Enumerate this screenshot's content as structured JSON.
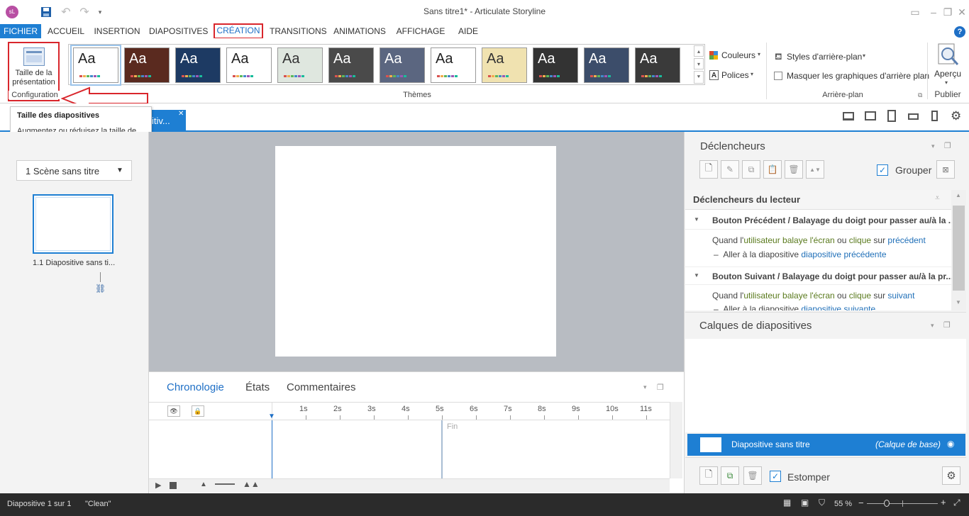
{
  "app": {
    "title": "Sans titre1* -  Articulate Storyline",
    "logo_text": "sL"
  },
  "menu": {
    "tabs": [
      "FICHIER",
      "ACCUEIL",
      "INSERTION",
      "DIAPOSITIVES",
      "CRÉATION",
      "TRANSITIONS",
      "ANIMATIONS",
      "AFFICHAGE",
      "AIDE"
    ],
    "active": "CRÉATION"
  },
  "ribbon": {
    "size_button": "Taille de la présentation",
    "group_config": "Configuration",
    "group_themes": "Thèmes",
    "colors_label": "Couleurs",
    "fonts_label": "Polices",
    "bg_styles_label": "Styles d'arrière-plan",
    "hide_bg_label": "Masquer les graphiques d'arrière plan",
    "group_bg": "Arrière-plan",
    "preview_label": "Aperçu",
    "group_publish": "Publier",
    "theme_thumb_text": "Aa",
    "themes": [
      {
        "bg": "#ffffff",
        "fg": "#222222"
      },
      {
        "bg": "#5a2a1f",
        "fg": "#ffffff"
      },
      {
        "bg": "#1d3a63",
        "fg": "#ffffff"
      },
      {
        "bg": "#ffffff",
        "fg": "#222222"
      },
      {
        "bg": "#dfe7df",
        "fg": "#333333"
      },
      {
        "bg": "#4a4a4a",
        "fg": "#ffffff"
      },
      {
        "bg": "#5b6680",
        "fg": "#ffffff"
      },
      {
        "bg": "#ffffff",
        "fg": "#222222"
      },
      {
        "bg": "#f0e2b0",
        "fg": "#333333"
      },
      {
        "bg": "#333333",
        "fg": "#ffffff"
      },
      {
        "bg": "#3c4d6a",
        "fg": "#ffffff"
      },
      {
        "bg": "#3a3a3a",
        "fg": "#ffffff"
      }
    ]
  },
  "tooltip": {
    "title": "Taille des diapositives",
    "body": "Augmentez ou réduisez la taille de votre présentation."
  },
  "doc_tab": {
    "label": "itiv..."
  },
  "left": {
    "scene_select": "1 Scène sans titre",
    "slide_label": "1.1 Diapositive sans ti..."
  },
  "timeline": {
    "tabs": [
      "Chronologie",
      "États",
      "Commentaires"
    ],
    "ticks": [
      "1s",
      "2s",
      "3s",
      "4s",
      "5s",
      "6s",
      "7s",
      "8s",
      "9s",
      "10s",
      "11s"
    ],
    "end_label": "Fin"
  },
  "triggers": {
    "title": "Déclencheurs",
    "group_label": "Grouper",
    "player_header": "Déclencheurs du lecteur",
    "items": [
      {
        "header": "Bouton Précédent / Balayage du doigt pour passer au/à la ...",
        "line1": [
          "Quand l'",
          "utilisateur balaye l'écran",
          " ou ",
          "clique",
          " sur ",
          "précédent"
        ],
        "line2": [
          "Aller à la diapositive ",
          "diapositive précédente"
        ]
      },
      {
        "header": "Bouton Suivant / Balayage du doigt pour passer au/à la pr...",
        "line1": [
          "Quand l'",
          "utilisateur balaye l'écran",
          " ou ",
          "clique",
          " sur ",
          "suivant"
        ],
        "line2": [
          "Aller à la diapositive ",
          "diapositive suivante"
        ]
      }
    ]
  },
  "layers": {
    "title": "Calques de diapositives",
    "base_name": "Diapositive sans titre",
    "base_tag": "(Calque de base)",
    "dim_label": "Estomper"
  },
  "status": {
    "slide_info": "Diapositive 1 sur 1",
    "theme": "\"Clean\"",
    "zoom": "55 %"
  },
  "colors": {
    "accent": "#1e7fd3",
    "highlight_red": "#d9262c"
  }
}
